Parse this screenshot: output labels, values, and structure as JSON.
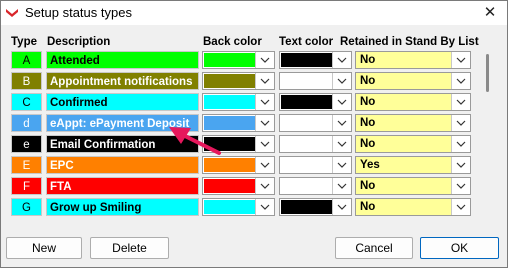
{
  "window": {
    "title": "Setup status types",
    "close_glyph": "✕",
    "app_icon": "app-logo-icon"
  },
  "columns": {
    "type": "Type",
    "description": "Description",
    "back_color": "Back color",
    "text_color": "Text color",
    "retained": "Retained in Stand By List"
  },
  "rows": [
    {
      "code": "A",
      "description": "Attended",
      "code_bg": "#00ff00",
      "desc_bg": "#00ff00",
      "desc_fg": "#000000",
      "back_color": "#00ff00",
      "text_color": "#000000",
      "retained": "No"
    },
    {
      "code": "B",
      "description": "Appointment notifications",
      "code_bg": "#808000",
      "desc_bg": "#808000",
      "desc_fg": "#ffffff",
      "back_color": "#808000",
      "text_color": "#ffffff",
      "retained": "No"
    },
    {
      "code": "C",
      "description": "Confirmed",
      "code_bg": "#00ffff",
      "desc_bg": "#00ffff",
      "desc_fg": "#000000",
      "back_color": "#00ffff",
      "text_color": "#000000",
      "retained": "No"
    },
    {
      "code": "d",
      "description": "eAppt: ePayment Deposit",
      "code_bg": "#4aa5f0",
      "desc_bg": "#4aa5f0",
      "desc_fg": "#ffffff",
      "back_color": "#4aa5f0",
      "text_color": "#ffffff",
      "retained": "No"
    },
    {
      "code": "e",
      "description": "Email Confirmation",
      "code_bg": "#000000",
      "desc_bg": "#000000",
      "desc_fg": "#ffffff",
      "back_color": "#000000",
      "text_color": "#ffffff",
      "retained": "No"
    },
    {
      "code": "E",
      "description": "EPC",
      "code_bg": "#ff8000",
      "desc_bg": "#ff8000",
      "desc_fg": "#ffffff",
      "back_color": "#ff8000",
      "text_color": "#ffffff",
      "retained": "Yes"
    },
    {
      "code": "F",
      "description": "FTA",
      "code_bg": "#ff0000",
      "desc_bg": "#ff0000",
      "desc_fg": "#ffffff",
      "back_color": "#ff0000",
      "text_color": "#ffffff",
      "retained": "No"
    },
    {
      "code": "G",
      "description": "Grow up Smiling",
      "code_bg": "#00ffff",
      "desc_bg": "#00ffff",
      "desc_fg": "#000000",
      "back_color": "#00ffff",
      "text_color": "#000000",
      "retained": "No"
    }
  ],
  "buttons": {
    "new": "New",
    "delete": "Delete",
    "cancel": "Cancel",
    "ok": "OK"
  },
  "colors": {
    "retained_bg": "#ffff99",
    "ok_border": "#0067c0",
    "callout": "#e6175c"
  }
}
